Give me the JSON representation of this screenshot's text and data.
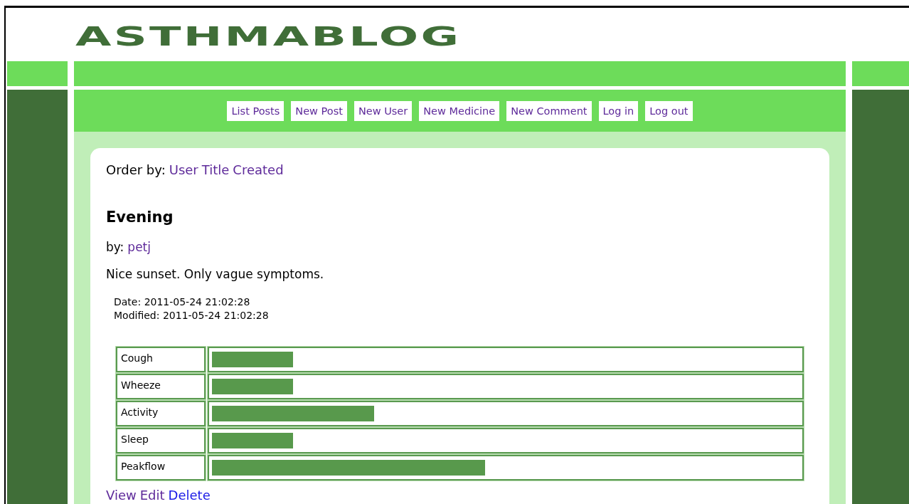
{
  "logo": "ASTHMABLOG",
  "nav": [
    {
      "label": "List Posts"
    },
    {
      "label": "New Post"
    },
    {
      "label": "New User"
    },
    {
      "label": "New Medicine"
    },
    {
      "label": "New Comment"
    },
    {
      "label": "Log in"
    },
    {
      "label": "Log out"
    }
  ],
  "order_by": {
    "label": "Order by:",
    "links": [
      {
        "label": "User"
      },
      {
        "label": "Title"
      },
      {
        "label": "Created"
      }
    ]
  },
  "post": {
    "title": "Evening",
    "by_label": "by:",
    "author": "petj",
    "body": "Nice sunset. Only vague symptoms.",
    "date": "Date: 2011-05-24 21:02:28",
    "modified": "Modified: 2011-05-24 21:02:28",
    "symptoms": [
      {
        "name": "Cough",
        "level": 0.137
      },
      {
        "name": "Wheeze",
        "level": 0.137
      },
      {
        "name": "Activity",
        "level": 0.273
      },
      {
        "name": "Sleep",
        "level": 0.137
      },
      {
        "name": "Peakflow",
        "level": 0.46
      }
    ],
    "actions": [
      {
        "label": "View",
        "kind": "visited"
      },
      {
        "label": "Edit",
        "kind": "visited"
      },
      {
        "label": "Delete",
        "kind": "link"
      }
    ]
  }
}
